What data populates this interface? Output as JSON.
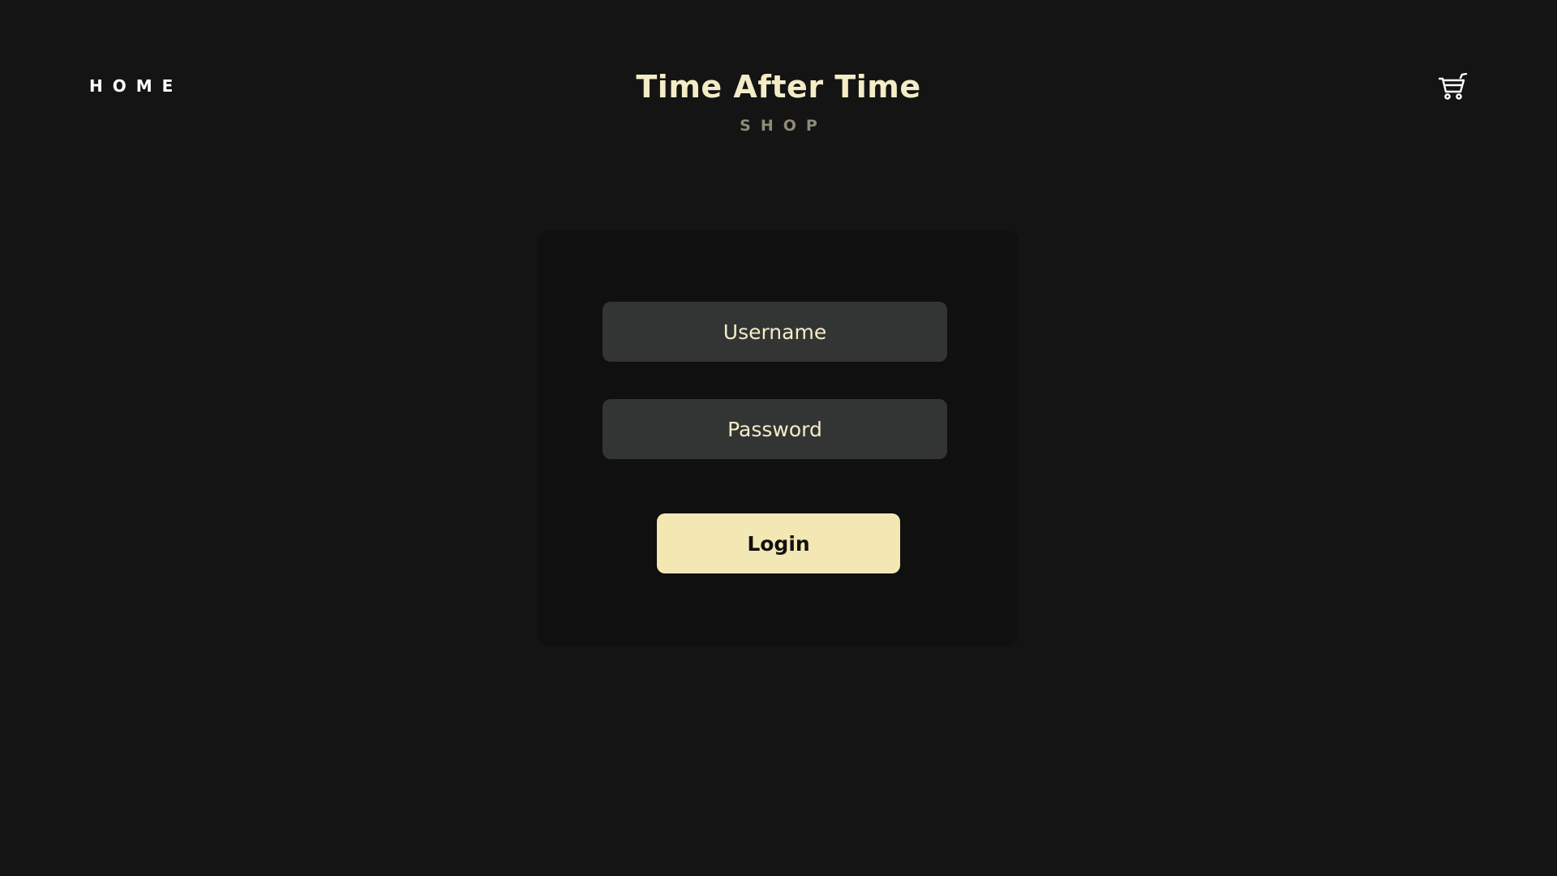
{
  "nav": {
    "home_label": "HOME"
  },
  "brand": {
    "title": "Time After Time",
    "subtitle": "SHOP"
  },
  "cart": {
    "icon": "shopping-cart-icon"
  },
  "login_form": {
    "username_placeholder": "Username",
    "password_placeholder": "Password",
    "submit_label": "Login"
  },
  "colors": {
    "background": "#141414",
    "card_background": "#101010",
    "field_background": "#333534",
    "accent_cream": "#f4ecc6",
    "button_background": "#f3e8b4",
    "subtitle_gray": "#8f8b77"
  }
}
